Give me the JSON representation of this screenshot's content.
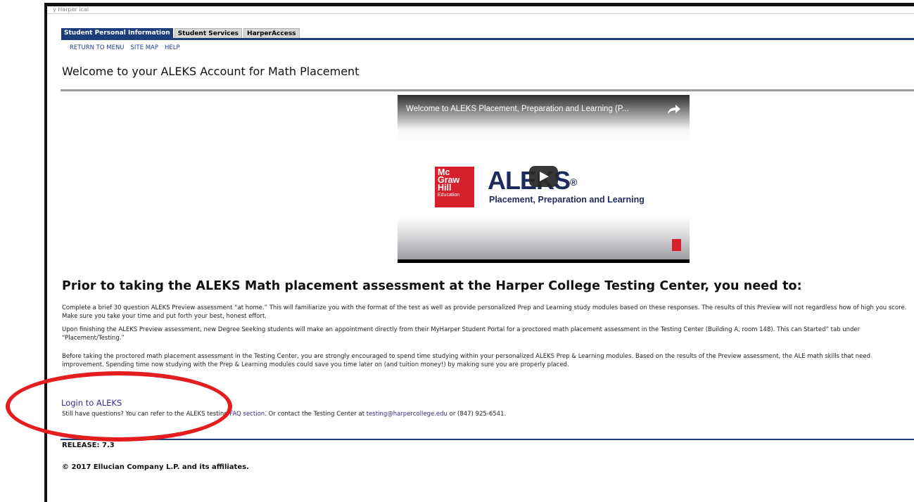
{
  "top_strip": {
    "text": "y Harper ical"
  },
  "tabs": [
    {
      "label": "Student Personal Information",
      "active": true
    },
    {
      "label": "Student Services",
      "active": false
    },
    {
      "label": "HarperAccess",
      "active": false
    }
  ],
  "subnav": {
    "return": "RETURN TO MENU",
    "sitemap": "SITE MAP",
    "help": "HELP"
  },
  "page": {
    "title": "Welcome to your ALEKS Account for Math Placement"
  },
  "video": {
    "title": "Welcome to ALEKS Placement, Preparation and Learning (P...",
    "logo_lines": [
      "Mc",
      "Graw",
      "Hill",
      "Education"
    ],
    "brand": "ALEKS",
    "brand_mark": "®",
    "brand_sub": "Placement, Preparation and Learning"
  },
  "content": {
    "heading": "Prior to taking the ALEKS Math placement assessment at the Harper College Testing Center, you need to:",
    "p1": "Complete a brief 30 question ALEKS Preview assessment “at home.” This will familiarize you with the format of the test as well as provide personalized Prep and Learning study modules based on these responses. The results of this Preview will not regardless how of high you score. Make sure you take your time and put forth your best, honest effort.",
    "p2": "Upon finishing the ALEKS Preview assessment, new Degree Seeking students will make an appointment directly from their MyHarper Student Portal for a proctored math placement assessment in the Testing Center (Building A, room 148). This can Started” tab under “Placement/Testing.”",
    "p3": "Before taking the proctored math placement assessment in the Testing Center, you are strongly encouraged to spend time studying within your personalized ALEKS Prep & Learning modules. Based on the results of the Preview assessment, the ALE math skills that need improvement. Spending time now studying with the Prep & Learning modules could save you time later on (and tuition money!) by making sure you are properly placed."
  },
  "login": {
    "label": "Login to ALEKS"
  },
  "questions": {
    "prefix": "Still have questions? You can refer to the ALEKS testing ",
    "faq_link": "FAQ section",
    "middle": ". Or contact the Testing Center at ",
    "email": "testing@harpercollege.edu",
    "suffix": " or (847) 925-6541."
  },
  "footer": {
    "release": "RELEASE: 7.3",
    "copyright": "© 2017 Ellucian Company L.P. and its affiliates."
  },
  "colors": {
    "tab_active": "#1d3d7a",
    "annotation": "#e41e1e",
    "link": "#3a2a8a",
    "brand_red": "#d6202c"
  }
}
